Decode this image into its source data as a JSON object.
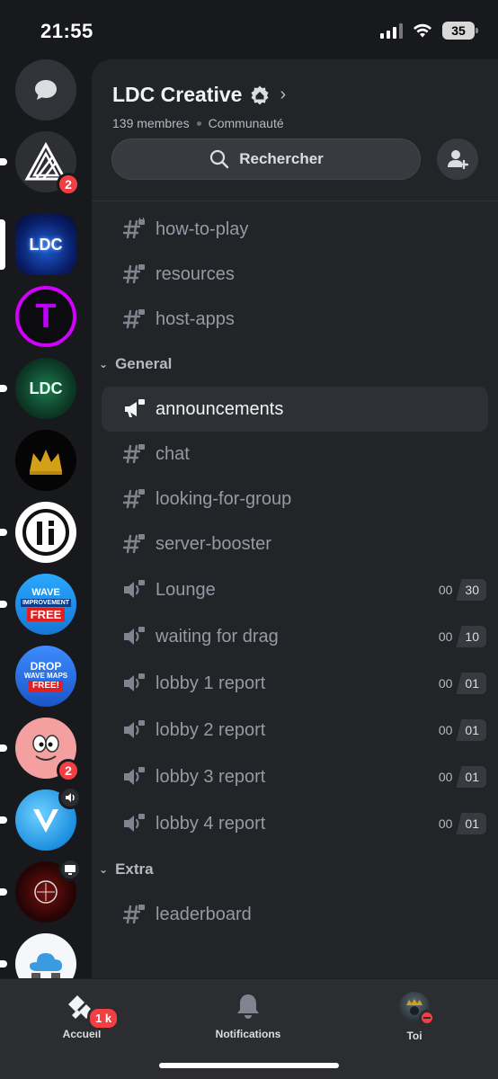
{
  "status_bar": {
    "time": "21:55",
    "battery": "35"
  },
  "servers": [
    {
      "name": "direct-messages"
    },
    {
      "name": "server-triangle",
      "badge": "2"
    },
    {
      "name": "server-ldc-blue",
      "text": "LDC"
    },
    {
      "name": "server-t-purple",
      "text": "T"
    },
    {
      "name": "server-ldc-green",
      "text": "LDC"
    },
    {
      "name": "server-crown"
    },
    {
      "name": "server-i-logo"
    },
    {
      "name": "server-wave",
      "text_top": "WAVE",
      "text_mid": "IMPROVEMENT",
      "text_bot": "FREE"
    },
    {
      "name": "server-drop",
      "text_top": "DROP",
      "text_mid": "WAVE MAPS",
      "text_bot": "FREE!"
    },
    {
      "name": "server-patrick",
      "badge": "2"
    },
    {
      "name": "server-v-blue"
    },
    {
      "name": "server-red-dark"
    },
    {
      "name": "server-cloud"
    }
  ],
  "header": {
    "title": "LDC Creative",
    "members": "139 membres",
    "community": "Communauté"
  },
  "search": {
    "label": "Rechercher"
  },
  "channels_top": [
    {
      "name": "how-to-play",
      "type": "text"
    },
    {
      "name": "resources",
      "type": "text"
    },
    {
      "name": "host-apps",
      "type": "text"
    }
  ],
  "category_general": "General",
  "channels_general": [
    {
      "name": "announcements",
      "type": "announce"
    },
    {
      "name": "chat",
      "type": "text"
    },
    {
      "name": "looking-for-group",
      "type": "text"
    },
    {
      "name": "server-booster",
      "type": "text"
    },
    {
      "name": "Lounge",
      "type": "voice",
      "users": "00",
      "limit": "30"
    },
    {
      "name": "waiting for drag",
      "type": "voice",
      "users": "00",
      "limit": "10"
    },
    {
      "name": "lobby 1 report",
      "type": "voice",
      "users": "00",
      "limit": "01"
    },
    {
      "name": "lobby 2 report",
      "type": "voice",
      "users": "00",
      "limit": "01"
    },
    {
      "name": "lobby 3 report",
      "type": "voice",
      "users": "00",
      "limit": "01"
    },
    {
      "name": "lobby 4 report",
      "type": "voice",
      "users": "00",
      "limit": "01"
    }
  ],
  "category_extra": "Extra",
  "channels_extra": [
    {
      "name": "leaderboard",
      "type": "text"
    }
  ],
  "tabs": [
    {
      "label": "Accueil",
      "badge": "1 k"
    },
    {
      "label": "Notifications"
    },
    {
      "label": "Toi"
    }
  ]
}
